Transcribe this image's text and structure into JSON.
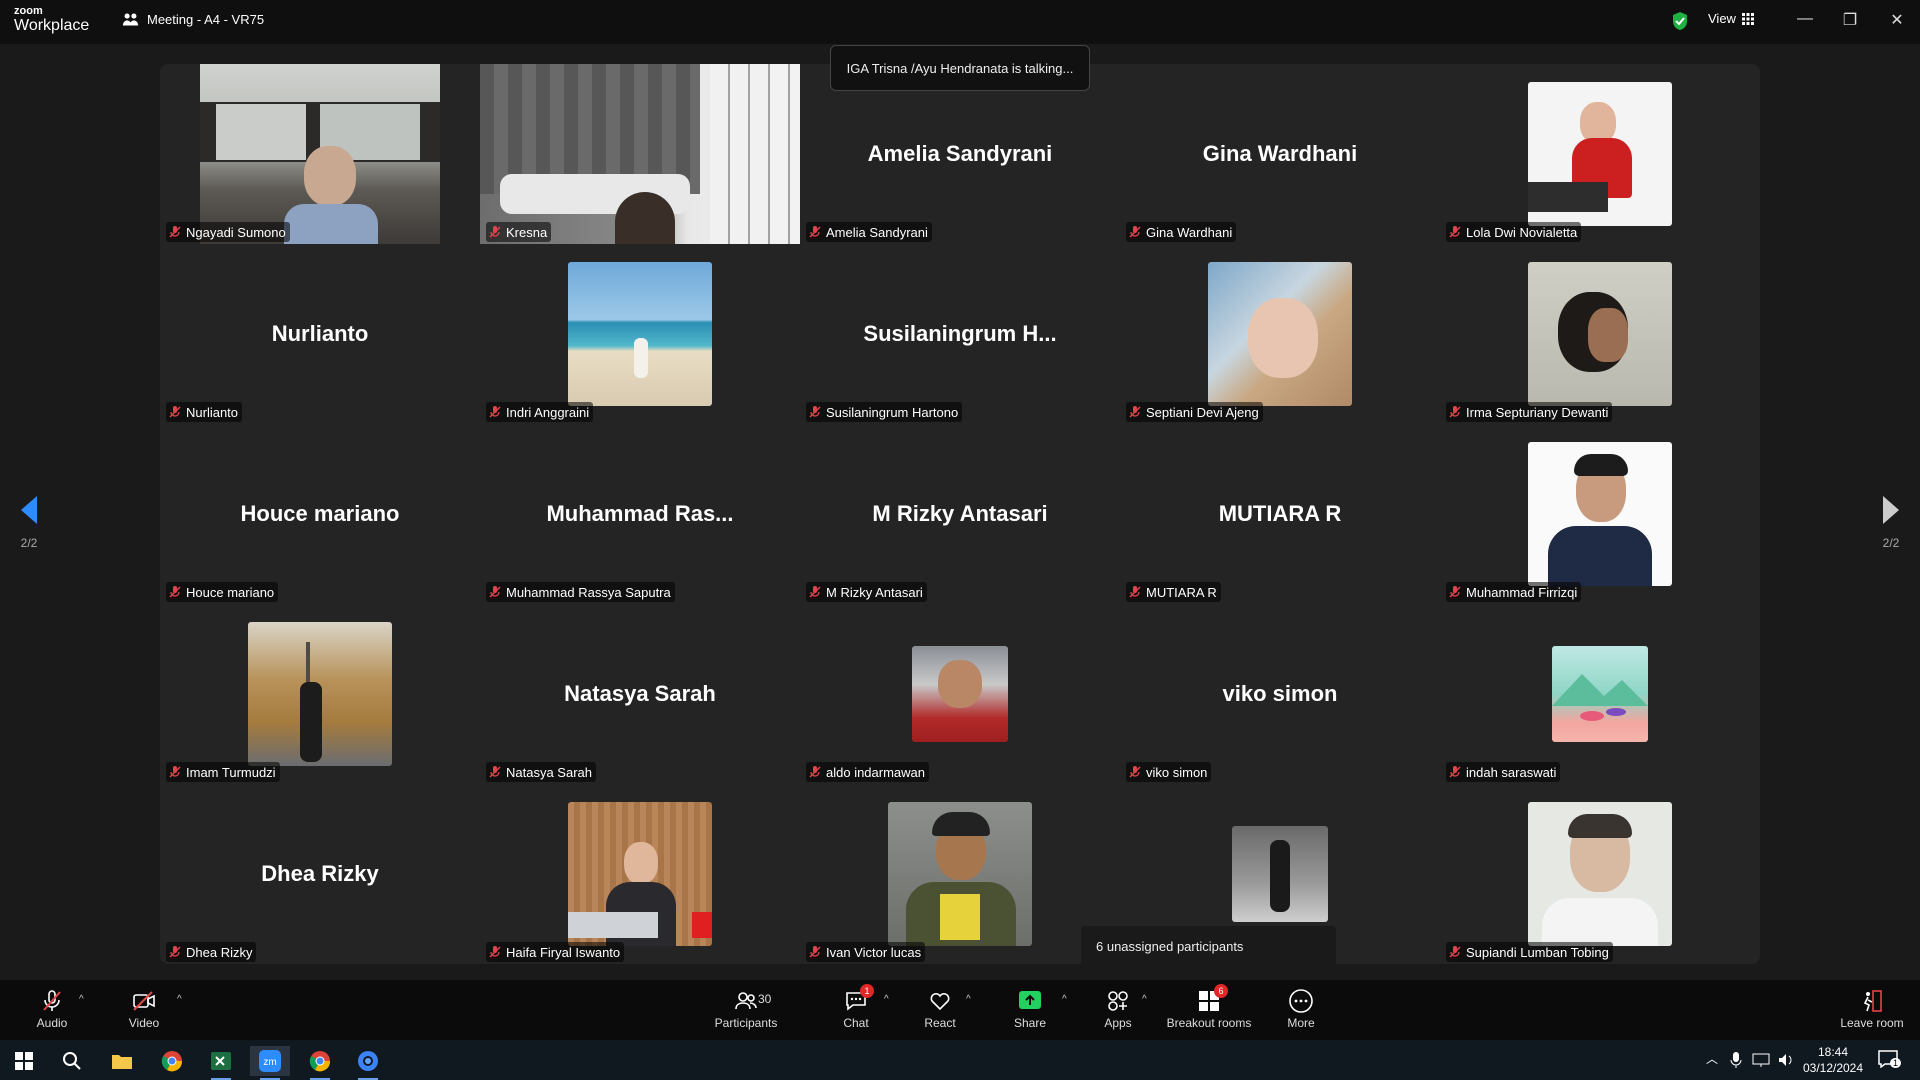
{
  "titlebar": {
    "brand_top": "zoom",
    "brand_bottom": "Workplace",
    "meeting_title": "Meeting - A4 - VR75",
    "view_label": "View",
    "minimize": "—",
    "restore": "❐",
    "close": "✕"
  },
  "toast": "IGA Trisna /Ayu Hendranata is talking...",
  "unassigned": "6 unassigned participants",
  "pager": {
    "left": "2/2",
    "right": "2/2"
  },
  "tiles": [
    {
      "label": "Ngayadi Sumono",
      "center": ""
    },
    {
      "label": "Kresna",
      "center": ""
    },
    {
      "label": "Amelia Sandyrani",
      "center": "Amelia Sandyrani"
    },
    {
      "label": "Gina Wardhani",
      "center": "Gina Wardhani"
    },
    {
      "label": "Lola Dwi Novialetta",
      "center": ""
    },
    {
      "label": "Nurlianto",
      "center": "Nurlianto"
    },
    {
      "label": "Indri Anggraini",
      "center": ""
    },
    {
      "label": "Susilaningrum Hartono",
      "center": "Susilaningrum  H..."
    },
    {
      "label": "Septiani Devi Ajeng",
      "center": ""
    },
    {
      "label": "Irma Septuriany Dewanti",
      "center": ""
    },
    {
      "label": "Houce mariano",
      "center": "Houce mariano"
    },
    {
      "label": "Muhammad Rassya Saputra",
      "center": "Muhammad  Ras..."
    },
    {
      "label": "M Rizky Antasari",
      "center": "M Rizky Antasari"
    },
    {
      "label": "MUTIARA R",
      "center": "MUTIARA R"
    },
    {
      "label": "Muhammad Firrizqi",
      "center": ""
    },
    {
      "label": "Imam Turmudzi",
      "center": ""
    },
    {
      "label": "Natasya Sarah",
      "center": "Natasya Sarah"
    },
    {
      "label": "aldo indarmawan",
      "center": ""
    },
    {
      "label": "viko simon",
      "center": "viko simon"
    },
    {
      "label": "indah saraswati",
      "center": ""
    },
    {
      "label": "Dhea Rizky",
      "center": "Dhea Rizky"
    },
    {
      "label": "Haifa Firyal Iswanto",
      "center": ""
    },
    {
      "label": "Ivan Victor lucas",
      "center": ""
    },
    {
      "label": "",
      "center": ""
    },
    {
      "label": "Supiandi Lumban Tobing",
      "center": ""
    }
  ],
  "toolbar": {
    "audio": "Audio",
    "video": "Video",
    "participants": "Participants",
    "participants_count": "30",
    "chat": "Chat",
    "chat_badge": "1",
    "react": "React",
    "share": "Share",
    "apps": "Apps",
    "breakout": "Breakout rooms",
    "breakout_badge": "6",
    "more": "More",
    "leave": "Leave room"
  },
  "taskbar": {
    "time": "18:44",
    "date": "03/12/2024",
    "notif_count": "1"
  },
  "colors": {
    "accent_blue": "#2d8cff",
    "share_green": "#23d160",
    "shield_green": "#1fb141",
    "badge_red": "#e02828",
    "muted_red": "#e0454a"
  }
}
